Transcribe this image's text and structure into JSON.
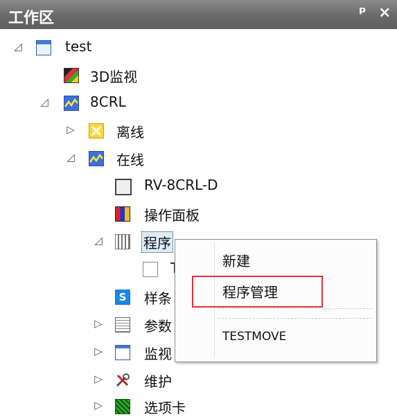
{
  "panel": {
    "title": "工作区",
    "pin_glyph": "ᵖ",
    "close_glyph": "×"
  },
  "tree": {
    "root": {
      "label": "test",
      "expander": "◿",
      "icon": "app-window-icon"
    },
    "view3d": {
      "label": "3D监视",
      "icon": "3d-monitor-icon"
    },
    "robot": {
      "label": "8CRL",
      "expander": "◿",
      "icon": "waveform-icon"
    },
    "offline": {
      "label": "离线",
      "expander": "▷",
      "icon": "offline-x-icon"
    },
    "online": {
      "label": "在线",
      "expander": "◿",
      "icon": "waveform-icon"
    },
    "controller": {
      "label": "RV-8CRL-D",
      "icon": "controller-icon"
    },
    "op_panel": {
      "label": "操作面板",
      "icon": "control-panel-icon"
    },
    "program": {
      "label": "程序",
      "expander": "◿",
      "icon": "program-icon"
    },
    "program_child": {
      "label": "T",
      "icon": "document-icon"
    },
    "sample": {
      "label": "样条",
      "icon": "spline-icon",
      "icon_text": "S"
    },
    "params": {
      "label": "参数",
      "expander": "▷",
      "icon": "parameter-icon"
    },
    "monitor": {
      "label": "监视",
      "expander": "▷",
      "icon": "monitor-window-icon"
    },
    "maint": {
      "label": "维护",
      "expander": "▷",
      "icon": "tools-icon"
    },
    "options": {
      "label": "选项卡",
      "expander": "▷",
      "icon": "option-card-icon"
    }
  },
  "context_menu": {
    "items": [
      {
        "label": "新建"
      },
      {
        "label": "程序管理",
        "highlighted": true
      },
      {
        "label": "TESTMOVE"
      }
    ]
  },
  "colors": {
    "title_bar": "#6a6a6a",
    "highlight_border": "#e0303a",
    "selection_bg": "#dcecfc"
  }
}
